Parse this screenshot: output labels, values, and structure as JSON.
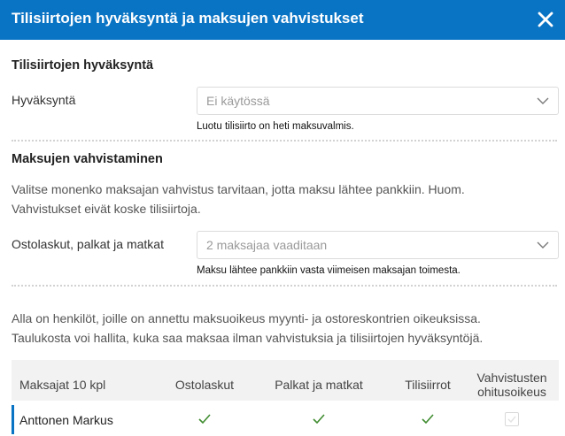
{
  "dialog": {
    "title": "Tilisiirtojen hyväksyntä ja maksujen vahvistukset"
  },
  "transfer_approval": {
    "section_title": "Tilisiirtojen hyväksyntä",
    "field_label": "Hyväksyntä",
    "selected_value": "Ei käytössä",
    "hint": "Luotu tilisiirto on heti maksuvalmis."
  },
  "payment_confirmation": {
    "section_title": "Maksujen vahvistaminen",
    "description_line1": "Valitse monenko maksajan vahvistus tarvitaan, jotta maksu lähtee pankkiin. Huom.",
    "description_line2": "Vahvistukset eivät koske tilisiirtoja.",
    "field_label": "Ostolaskut, palkat ja matkat",
    "selected_value": "2 maksajaa vaaditaan",
    "hint": "Maksu lähtee pankkiin vasta viimeisen maksajan toimesta."
  },
  "payers_info": {
    "line1": "Alla on henkilöt, joille on annettu maksuoikeus myynti- ja ostoreskontrien oikeuksissa.",
    "line2": "Taulukosta voi hallita, kuka saa maksaa ilman vahvistuksia ja tilisiirtojen hyväksyntöjä."
  },
  "table": {
    "headers": {
      "payers": "Maksajat 10 kpl",
      "purchase_invoices": "Ostolaskut",
      "salaries_travel": "Palkat ja matkat",
      "transfers": "Tilisiirrot",
      "override_line1": "Vahvistusten",
      "override_line2": "ohitusoikeus"
    },
    "rows": [
      {
        "name": "Anttonen Markus",
        "purchase_invoices": true,
        "salaries_travel": true,
        "transfers": true,
        "override": false
      }
    ]
  },
  "colors": {
    "header_bg": "#0a74c4",
    "check": "#3f8c2f",
    "row_marker": "#0a74c4"
  },
  "icons": [
    "close-icon",
    "chevron-down-icon",
    "checkmark-icon",
    "checkbox-icon"
  ]
}
